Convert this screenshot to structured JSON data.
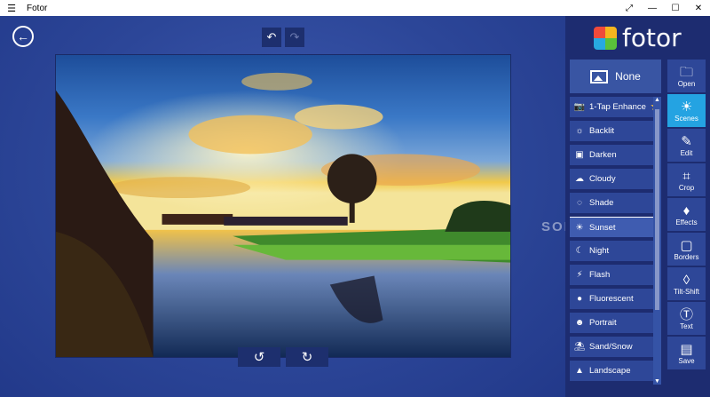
{
  "window": {
    "title": "Fotor",
    "menu_icon": "hamburger-icon"
  },
  "window_controls": [
    "⤢",
    "—",
    "☐",
    "✕"
  ],
  "top_controls": {
    "undo": "↶",
    "redo": "↷",
    "back": "←"
  },
  "rotate": {
    "left": "↺",
    "right": "↻"
  },
  "watermark": "SOFTPEDIA",
  "brand": {
    "name": "fotor"
  },
  "none_button": {
    "label": "None"
  },
  "scenes": [
    {
      "label": "1-Tap Enhance",
      "icon": "📷",
      "starred": true
    },
    {
      "label": "Backlit",
      "icon": "☼"
    },
    {
      "label": "Darken",
      "icon": "▣"
    },
    {
      "label": "Cloudy",
      "icon": "☁"
    },
    {
      "label": "Shade",
      "icon": "◌"
    },
    {
      "label": "Sunset",
      "icon": "☀",
      "selected": true
    },
    {
      "label": "Night",
      "icon": "☾"
    },
    {
      "label": "Flash",
      "icon": "⚡"
    },
    {
      "label": "Fluorescent",
      "icon": "●"
    },
    {
      "label": "Portrait",
      "icon": "☻"
    },
    {
      "label": "Sand/Snow",
      "icon": "⛱"
    },
    {
      "label": "Landscape",
      "icon": "▲"
    }
  ],
  "tools": [
    {
      "label": "Open",
      "icon": "🗀"
    },
    {
      "label": "Scenes",
      "icon": "☀",
      "active": true
    },
    {
      "label": "Edit",
      "icon": "✎"
    },
    {
      "label": "Crop",
      "icon": "⌗"
    },
    {
      "label": "Effects",
      "icon": "♦"
    },
    {
      "label": "Borders",
      "icon": "▢"
    },
    {
      "label": "Tilt-Shift",
      "icon": "◊"
    },
    {
      "label": "Text",
      "icon": "Ⓣ"
    },
    {
      "label": "Save",
      "icon": "▤"
    }
  ]
}
